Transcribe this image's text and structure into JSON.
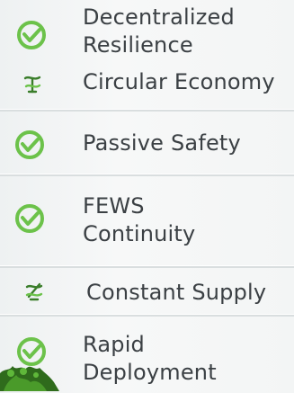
{
  "features": [
    {
      "icon": "green-check-circle-icon",
      "line1": "Decentralized",
      "line2": "Resilience"
    },
    {
      "icon": "water-symbol-icon",
      "line1": "Circular Economy",
      "line2": ""
    },
    {
      "icon": "green-check-circle-icon",
      "line1": "Passive Safety",
      "line2": ""
    },
    {
      "icon": "green-check-circle-icon",
      "line1": "FEWS",
      "line2": "Continuity"
    },
    {
      "icon": "water-symbol-icon",
      "line1": "Constant Supply",
      "line2": ""
    },
    {
      "icon": "green-check-circle-icon",
      "line1": "Rapid",
      "line2": "Deployment"
    }
  ],
  "colors": {
    "accent_green": "#6cc24a",
    "text": "#3b4044",
    "divider": "#d9dedf"
  }
}
